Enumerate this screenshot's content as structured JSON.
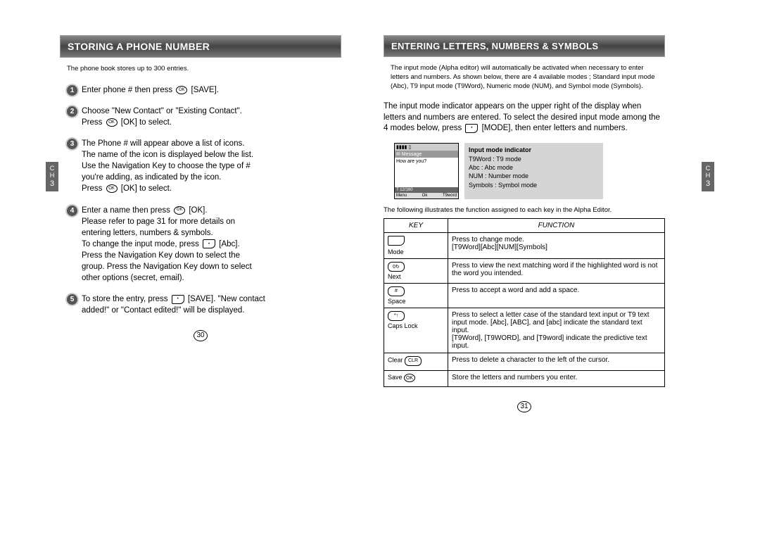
{
  "left_page": {
    "title": "STORING A PHONE NUMBER",
    "intro": "The phone book stores up to 300 entries.",
    "sidetab": {
      "ch": "C\nH",
      "num": "3"
    },
    "steps": [
      {
        "n": "1",
        "text": "Enter phone # then press {OK} [SAVE]."
      },
      {
        "n": "2",
        "text": "Choose \"New Contact\" or \"Existing Contact\".\nPress {OK} [OK] to select."
      },
      {
        "n": "3",
        "text": "The Phone # will appear above a list of icons.\nThe name of the icon is displayed below the list.\nUse the Navigation Key to choose the type of #\nyou're adding, as indicated by the icon.\nPress {OK} [OK] to select."
      },
      {
        "n": "4",
        "text": "Enter a name then press {OK} [OK].\nPlease refer to page 31 for more details on\nentering letters, numbers & symbols.\nTo change the input mode, press {SR} [Abc].\nPress the Navigation Key down to select the\ngroup. Press the Navigation Key down to select\nother options (secret, email)."
      },
      {
        "n": "5",
        "text": "To store the entry, press {SL} [SAVE]. \"New contact\nadded!\" or \"Contact edited!\" will be displayed."
      }
    ],
    "page_number": "30"
  },
  "right_page": {
    "title": "ENTERING LETTERS, NUMBERS & SYMBOLS",
    "intro_small": "The input mode (Alpha editor) will automatically be activated when necessary to enter letters and numbers. As shown below, there are 4 available modes ; Standard input mode (Abc), T9 input mode (T9Word), Numeric mode (NUM), and Symbol mode (Symbols).",
    "intro_large": "The input mode indicator appears on the upper right of the display when letters and numbers are entered. To select the desired input mode among the 4 modes below, press {SR} [MODE], then enter letters and numbers.",
    "sidetab": {
      "ch": "C\nH",
      "num": "3"
    },
    "phone_screen": {
      "titlebar": "▮▮▮▮  ▯",
      "msgbar": "✉ Message",
      "body": "How are you?",
      "counter": "T  12/160",
      "soft_left": "Menu",
      "soft_center": "Ok",
      "soft_right": "T9word"
    },
    "infobox": {
      "title": "Input mode indicator",
      "lines": [
        "T9Word : T9 mode",
        "Abc : Abc mode",
        "NUM : Number mode",
        "Symbols : Symbol mode"
      ]
    },
    "table_intro": "The following illustrates the function assigned to each key in the Alpha Editor.",
    "table": {
      "header_key": "KEY",
      "header_func": "FUNCTION",
      "rows": [
        {
          "key_icon": "softr",
          "icon_label": "",
          "key_label": "Mode",
          "func": "Press to change mode.\n[T9Word][Abc][NUM][Symbols]"
        },
        {
          "key_icon": "pill",
          "icon_label": "0↻",
          "key_label": "Next",
          "func": "Press to view the next matching word if the highlighted word is not the word you intended."
        },
        {
          "key_icon": "pill",
          "icon_label": "#",
          "key_label": "Space",
          "func": "Press to accept a word and add a space."
        },
        {
          "key_icon": "pill",
          "icon_label": "*↑",
          "key_label": "Caps Lock",
          "func": "Press to select a letter case of the standard text input or T9 text input mode. [Abc], [ABC], and [abc] indicate the standard text input.\n[T9Word], [T9WORD], and [T9word] indicate the predictive text input."
        },
        {
          "key_icon": "pill",
          "icon_label": "CLR",
          "key_label": "Clear",
          "func": "Press to delete a character to the left of the cursor.",
          "inline": true
        },
        {
          "key_icon": "round",
          "icon_label": "OK",
          "key_label": "Save",
          "func": "Store the letters and numbers you enter.",
          "inline": true
        }
      ]
    },
    "page_number": "31"
  }
}
